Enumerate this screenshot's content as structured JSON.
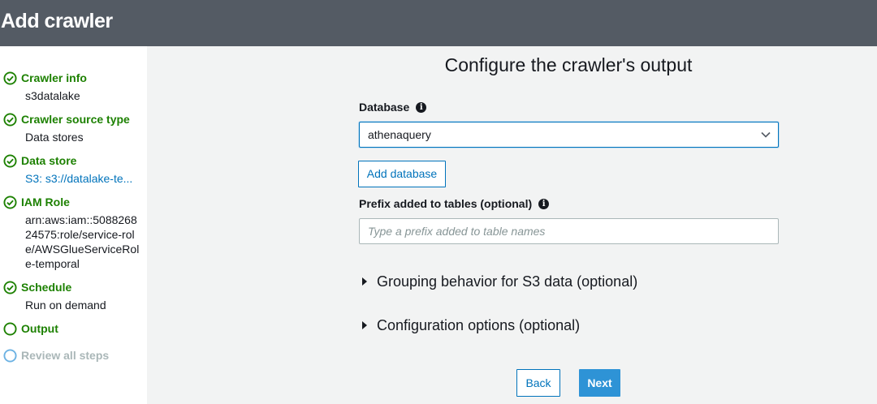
{
  "header": {
    "title": "Add crawler"
  },
  "sidebar": {
    "steps": [
      {
        "label": "Crawler info",
        "sub": "s3datalake",
        "status": "complete"
      },
      {
        "label": "Crawler source type",
        "sub": "Data stores",
        "status": "complete"
      },
      {
        "label": "Data store",
        "sub": "S3: s3://datalake-te...",
        "status": "complete"
      },
      {
        "label": "IAM Role",
        "sub": "arn:aws:iam::508826824575:role/service-role/AWSGlueServiceRole-temporal",
        "status": "complete"
      },
      {
        "label": "Schedule",
        "sub": "Run on demand",
        "status": "complete"
      },
      {
        "label": "Output",
        "sub": "",
        "status": "current"
      },
      {
        "label": "Review all steps",
        "sub": "",
        "status": "upcoming"
      }
    ]
  },
  "main": {
    "title": "Configure the crawler's output",
    "database": {
      "label": "Database",
      "value": "athenaquery"
    },
    "add_database_label": "Add database",
    "prefix": {
      "label": "Prefix added to tables (optional)",
      "placeholder": "Type a prefix added to table names",
      "value": ""
    },
    "expanders": [
      {
        "label": "Grouping behavior for S3 data (optional)"
      },
      {
        "label": "Configuration options (optional)"
      }
    ],
    "back_label": "Back",
    "next_label": "Next"
  },
  "colors": {
    "complete": "#1d8102",
    "current": "#1d8102",
    "upcoming": "#aab7b8",
    "accent": "#0073bb",
    "primary_button": "#2e93d6",
    "header_bg": "#545b64"
  },
  "icons": {
    "complete": "check-circle-icon",
    "current": "empty-circle-icon",
    "upcoming": "empty-circle-icon",
    "info": "info-icon",
    "select": "chevron-down-icon",
    "expander": "caret-right-icon"
  }
}
